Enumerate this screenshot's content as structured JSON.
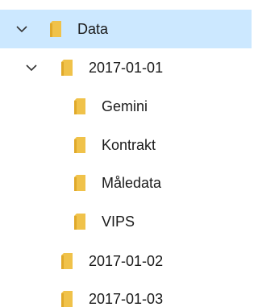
{
  "tree": {
    "items": [
      {
        "label": "Data",
        "level": 0,
        "expanded": true,
        "selected": true
      },
      {
        "label": "2017-01-01",
        "level": 1,
        "expanded": true,
        "selected": false
      },
      {
        "label": "Gemini",
        "level": 2,
        "expanded": false,
        "selected": false
      },
      {
        "label": "Kontrakt",
        "level": 2,
        "expanded": false,
        "selected": false
      },
      {
        "label": "Måledata",
        "level": 2,
        "expanded": false,
        "selected": false
      },
      {
        "label": "VIPS",
        "level": 2,
        "expanded": false,
        "selected": false
      },
      {
        "label": "2017-01-02",
        "level": 1,
        "expanded": false,
        "selected": false
      },
      {
        "label": "2017-01-03",
        "level": 1,
        "expanded": false,
        "selected": false
      }
    ]
  },
  "colors": {
    "selection": "#cce8ff",
    "folder": "#f0c24a",
    "chevron": "#333333",
    "text": "#1a1a1a"
  }
}
